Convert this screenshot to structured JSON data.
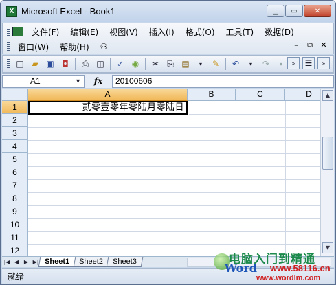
{
  "window": {
    "title": "Microsoft Excel - Book1",
    "app_icon": "X"
  },
  "menu": {
    "row1": [
      "文件(F)",
      "编辑(E)",
      "视图(V)",
      "插入(I)",
      "格式(O)",
      "工具(T)",
      "数据(D)"
    ],
    "row2": [
      "窗口(W)",
      "帮助(H)"
    ]
  },
  "formula_bar": {
    "name_box": "A1",
    "fx": "fx",
    "value": "20100606"
  },
  "columns": [
    "A",
    "B",
    "C",
    "D"
  ],
  "rows": [
    "1",
    "2",
    "3",
    "4",
    "5",
    "6",
    "7",
    "8",
    "9",
    "10",
    "11",
    "12"
  ],
  "cells": {
    "A1": "贰零壹零年零陆月零陆日"
  },
  "sheets": [
    "Sheet1",
    "Sheet2",
    "Sheet3"
  ],
  "status": "就绪",
  "watermark": {
    "main": "电脑入门到精通",
    "brand": "Word",
    "site": "www.58116.cn",
    "site2": "www.wordlm.com"
  },
  "colors": {
    "active_header": "#f1b95a",
    "title_bg": "#c8d7ea",
    "grid_line": "#d0d7e5"
  }
}
